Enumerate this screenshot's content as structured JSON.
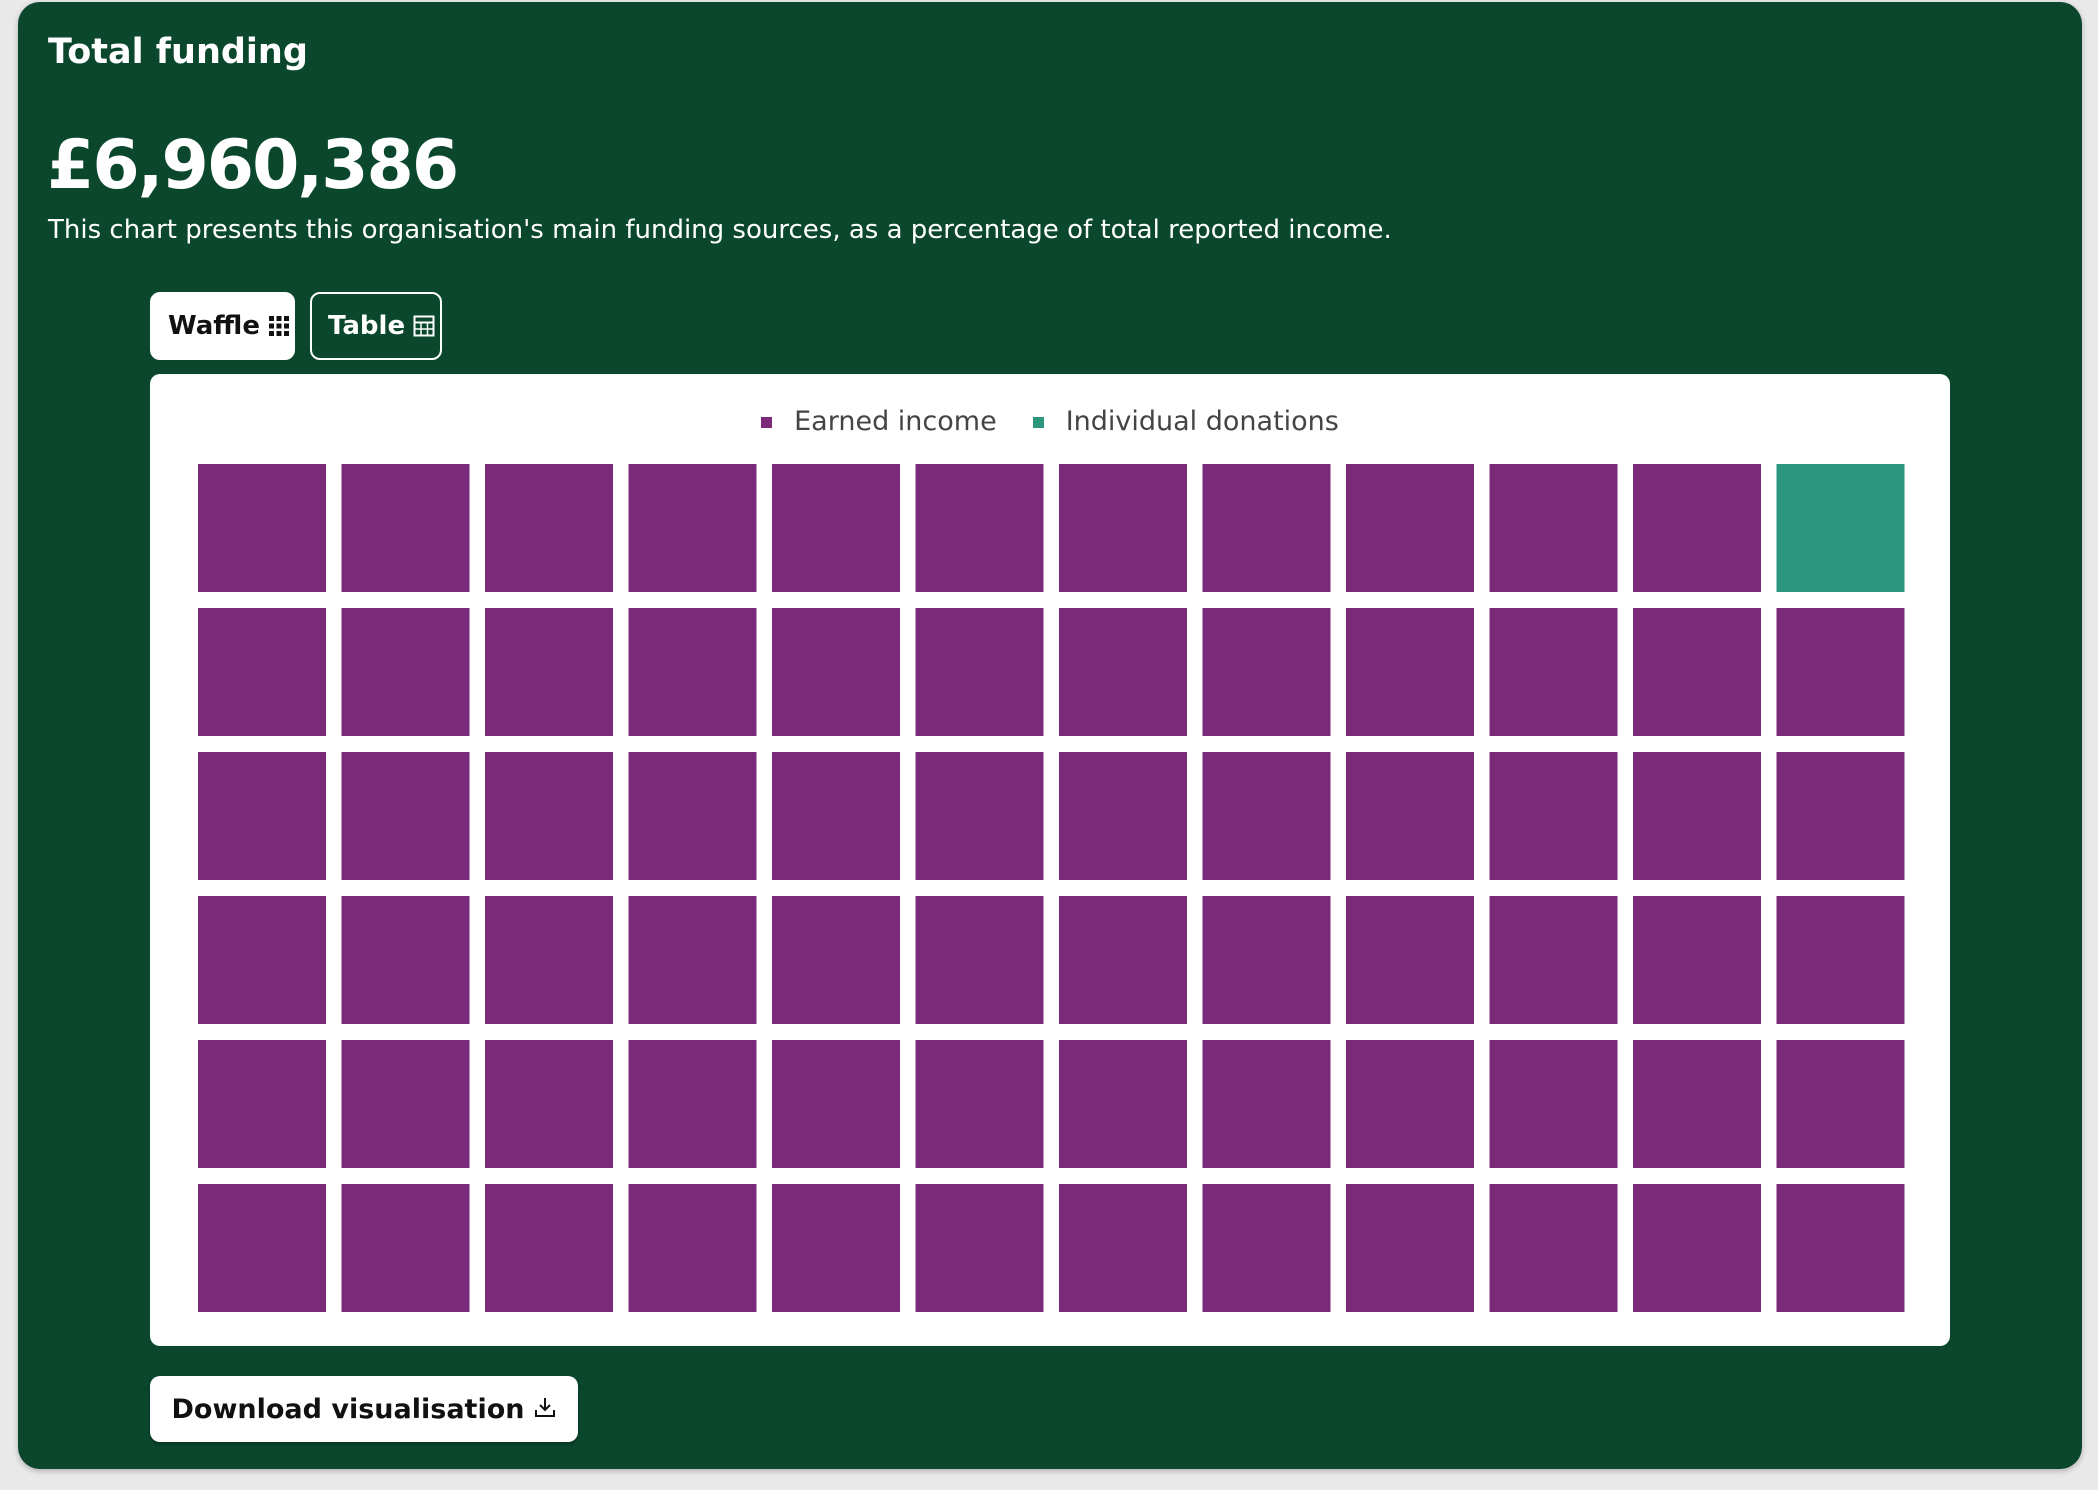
{
  "card": {
    "title": "Total funding",
    "amount": "£6,960,386",
    "description": "This chart presents this organisation's main funding sources, as a percentage of total reported income."
  },
  "view_toggle": {
    "waffle_label": "Waffle",
    "waffle_icon": "grid-icon",
    "table_label": "Table",
    "table_icon": "table-icon",
    "selected": "Waffle"
  },
  "download": {
    "label": "Download visualisation",
    "icon": "download-icon"
  },
  "colors": {
    "background": "#0a472d",
    "earned_income": "#7b2a7a",
    "individual_donations": "#2b967d"
  },
  "chart_data": {
    "type": "waffle",
    "rows": 6,
    "columns": 12,
    "total_cells": 72,
    "legend_position": "top-center",
    "series": [
      {
        "name": "Earned income",
        "cells": 71,
        "color": "#7b2a7a"
      },
      {
        "name": "Individual donations",
        "cells": 1,
        "color": "#2b967d"
      }
    ],
    "fill_order": "individual donations occupies top-right cell; earned income fills remaining cells"
  }
}
